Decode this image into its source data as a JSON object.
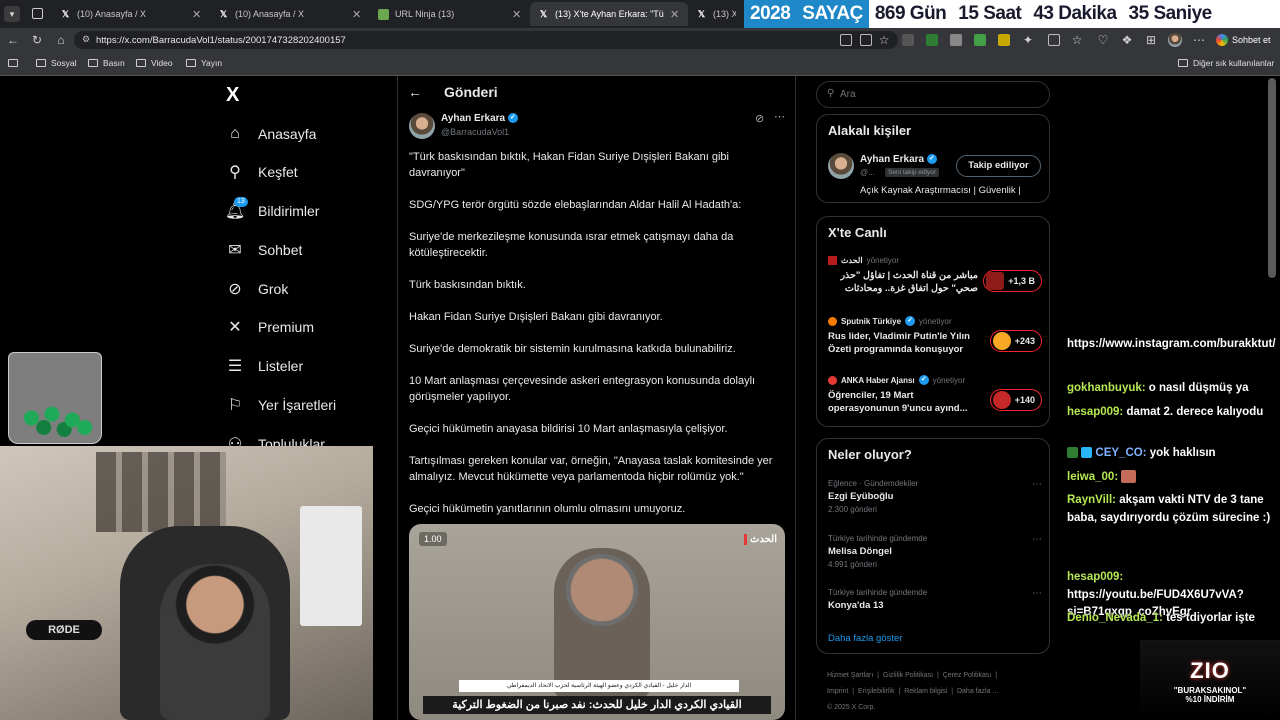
{
  "browser": {
    "tabs": [
      {
        "label": "(10) Anasayfa / X",
        "active": false
      },
      {
        "label": "(10) Anasayfa / X",
        "active": false
      },
      {
        "label": "URL Ninja (13)",
        "active": false
      },
      {
        "label": "(13) X'te Ayhan Erkara: \"Türk bask",
        "active": true
      },
      {
        "label": "(13) X'te",
        "active": false
      }
    ],
    "url": "https://x.com/BarracudaVol1/status/2001747328202400157",
    "chat_button": "Sohbet et",
    "bookmarks": [
      "Sosyal",
      "Basın",
      "Video",
      "Yayın"
    ],
    "other_bookmarks": "Diğer sık kullanılanlar"
  },
  "countdown": {
    "year": "2028",
    "label": "SAYAÇ",
    "days": "869 Gün",
    "hours": "15 Saat",
    "minutes": "43 Dakika",
    "seconds": "35 Saniye"
  },
  "nav": {
    "logo": "X",
    "items": [
      {
        "label": "Anasayfa",
        "icon": "home-icon"
      },
      {
        "label": "Keşfet",
        "icon": "search-icon"
      },
      {
        "label": "Bildirimler",
        "icon": "bell-icon",
        "badge": "13"
      },
      {
        "label": "Sohbet",
        "icon": "mail-icon"
      },
      {
        "label": "Grok",
        "icon": "grok-icon"
      },
      {
        "label": "Premium",
        "icon": "x-icon"
      },
      {
        "label": "Listeler",
        "icon": "list-icon"
      },
      {
        "label": "Yer İşaretleri",
        "icon": "bookmark-icon"
      },
      {
        "label": "Topluluklar",
        "icon": "community-icon"
      }
    ]
  },
  "post": {
    "header_title": "Gönderi",
    "author_name": "Ayhan Erkara",
    "author_handle": "@BarracudaVol1",
    "lines": [
      "\"Türk baskısından bıktık, Hakan Fidan Suriye Dışişleri Bakanı gibi davranıyor\"",
      "SDG/YPG terör örgütü sözde elebaşlarından Aldar Halil Al Hadath'a:",
      "Suriye'de merkezileşme konusunda ısrar etmek çatışmayı daha da kötüleştirecektir.",
      "Türk baskısından bıktık.",
      "Hakan Fidan Suriye Dışişleri Bakanı gibi davranıyor.",
      "Suriye'de demokratik bir sistemin kurulmasına katkıda bulunabiliriz.",
      "10 Mart anlaşması çerçevesinde askeri entegrasyon konusunda dolaylı görüşmeler yapılıyor.",
      "Geçici hükümetin anayasa bildirisi 10 Mart anlaşmasıyla çelişiyor.",
      "Tartışılması gereken konular var, örneğin, \"Anayasa taslak komitesinde yer almalıyız. Mevcut hükümette veya parlamentoda hiçbir rolümüz yok.\"",
      "Geçici hükümetin yanıtlarının olumlu olmasını umuyoruz."
    ],
    "media": {
      "speed": "1.00",
      "channel_logo": "الحدث",
      "lower_third_small": "الدار خليل - القيادي الكردي وعضو الهيئة الرئاسية لحزب الاتحاد الديمقراطي",
      "lower_third_main": "القيادي الكردي الدار خليل للحدث: نفد صبرنا من الضغوط التركية"
    }
  },
  "sidebar": {
    "search_placeholder": "Ara",
    "related": {
      "title": "Alakalı kişiler",
      "name": "Ayhan Erkara",
      "handle": "@...",
      "follows_you": "Seni takip ediyor",
      "bio": "Açık Kaynak Araştırmacısı | Güvenlik |",
      "follow_button": "Takip ediliyor"
    },
    "live": {
      "title": "X'te Canlı",
      "items": [
        {
          "source": "الحدث",
          "role": "yönetiyor",
          "text": "مباشر من قناة الحدث | تفاؤل \"حذر صحي\" حول اتفاق غزة.. ومحادثات",
          "count": "+1,3 B"
        },
        {
          "source": "Sputnik Türkiye",
          "role": "yönetiyor",
          "text": "Rus lider, Vladimir Putin'le Yılın Özeti programında konuşuyor",
          "count": "+243"
        },
        {
          "source": "ANKA Haber Ajansı",
          "role": "yönetiyor",
          "text": "Öğrenciler, 19 Mart operasyonunun 9'uncu ayınd...",
          "count": "+140"
        }
      ]
    },
    "trends": {
      "title": "Neler oluyor?",
      "items": [
        {
          "meta": "Eğlence · Gündemdekiler",
          "name": "Ezgi Eyüboğlu",
          "count": "2.300 gönderi"
        },
        {
          "meta": "Türkiye tarihinde gündemde",
          "name": "Melisa Döngel",
          "count": "4.991 gönderi"
        },
        {
          "meta": "Türkiye tarihinde gündemde",
          "name": "Konya'da 13",
          "count": ""
        }
      ],
      "show_more": "Daha fazla göster"
    },
    "footer": {
      "links": [
        "Hizmet Şartları",
        "Gizlilik Politikası",
        "Çerez Politikası",
        "Imprint",
        "Erişilebilirlik",
        "Reklam bilgisi",
        "Daha fazla ..."
      ],
      "copyright": "© 2025 X Corp."
    }
  },
  "stream_chat": [
    {
      "user": "",
      "text": "https://www.instagram.com/burakktut/"
    },
    {
      "user": "gokhanbuyuk:",
      "text": "o nasıl düşmüş ya"
    },
    {
      "user": "hesap009:",
      "text": "damat 2. derece kalıyodu"
    },
    {
      "user": "CEY_CO:",
      "text": "yok haklısın"
    },
    {
      "user": "leiwa_00:",
      "text": ""
    },
    {
      "user": "RaynVill:",
      "text": "akşam vakti NTV de 3 tane baba, saydırıyordu çözüm sürecine :)"
    },
    {
      "user": "hesap009:",
      "text": "https://youtu.be/FUD4X6U7vVA?si=B71qxgp_coZhvEgr"
    },
    {
      "user": "Denio_Nevada_1:",
      "text": "tes tdiyorlar işte"
    }
  ],
  "promo": {
    "logo": "ZIO",
    "line1": "\"BURAKSAKINOL\"",
    "line2": "%10 İNDİRİM"
  },
  "colors": {
    "accent": "#1d9bf0",
    "live": "#f4212e",
    "chat_user": "#b5e853",
    "countdown_blue": "#1e88c8"
  }
}
